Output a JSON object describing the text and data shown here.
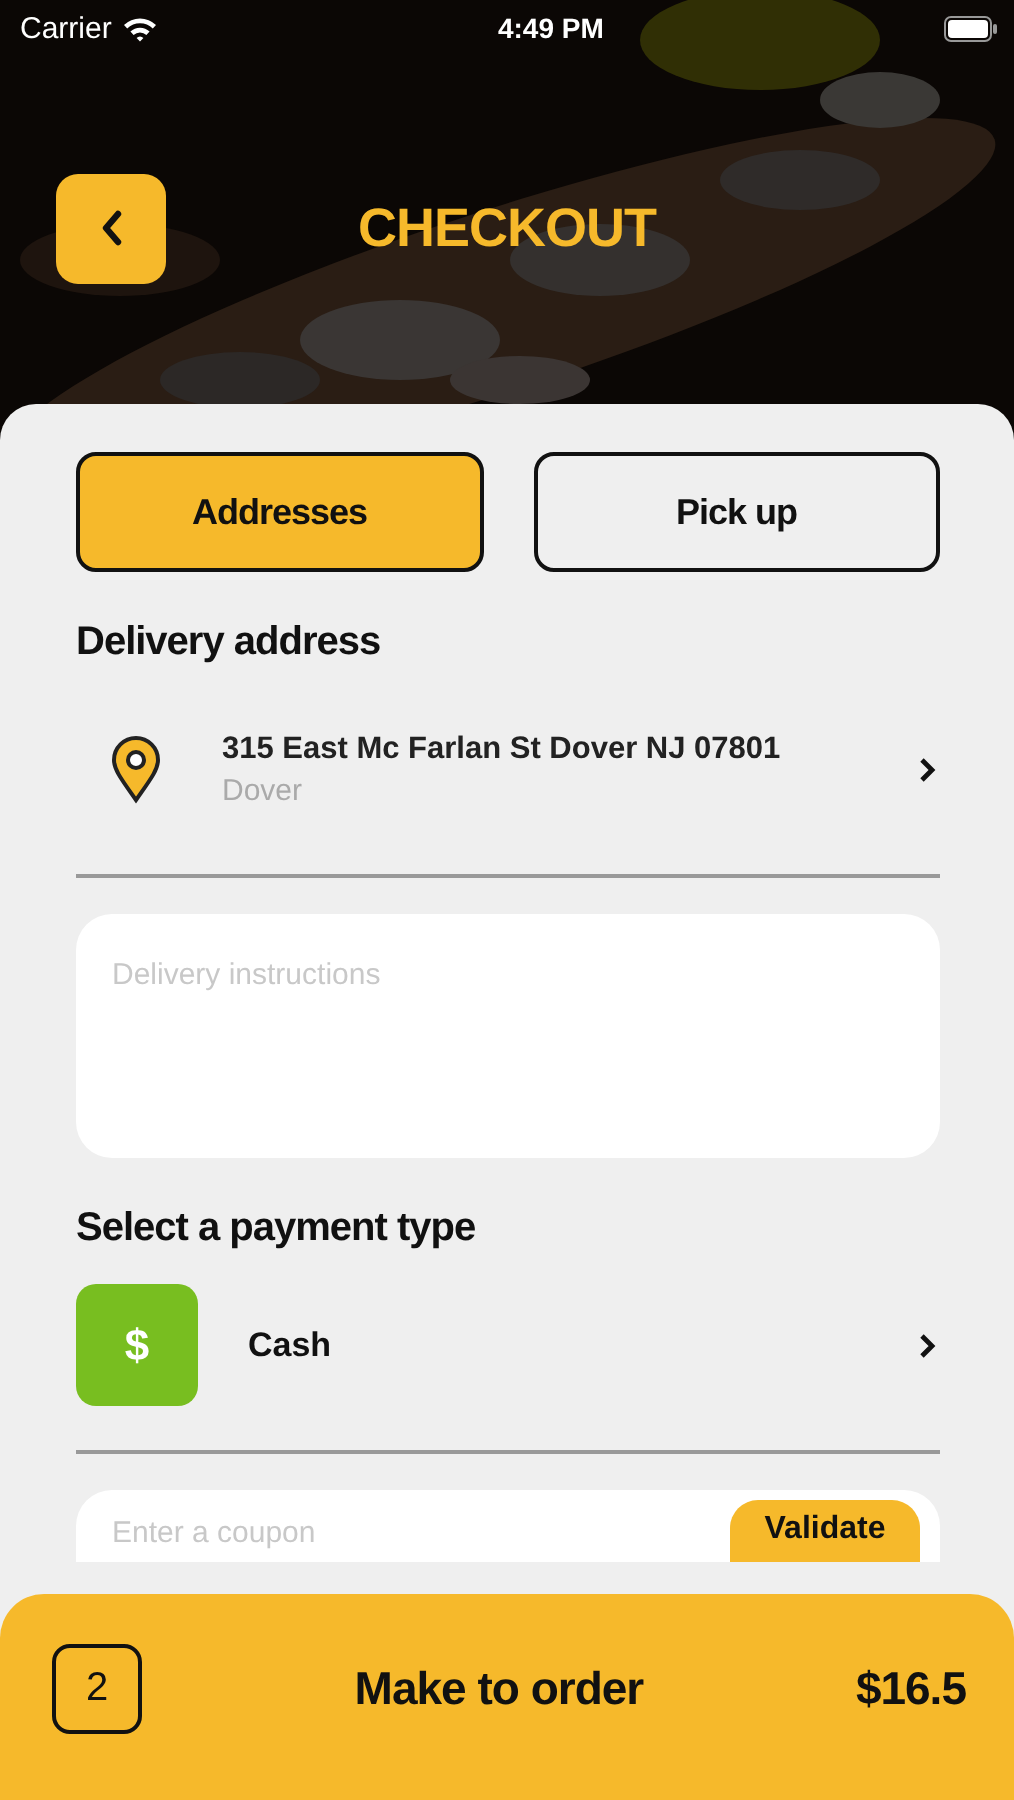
{
  "status_bar": {
    "carrier": "Carrier",
    "time": "4:49 PM"
  },
  "header": {
    "title": "CHECKOUT"
  },
  "tabs": [
    {
      "label": "Addresses",
      "selected": true
    },
    {
      "label": "Pick up",
      "selected": false
    }
  ],
  "delivery": {
    "heading": "Delivery address",
    "address": "315 East Mc Farlan St Dover NJ 07801",
    "city": "Dover",
    "instructions_placeholder": "Delivery instructions"
  },
  "payment": {
    "heading": "Select a payment type",
    "method": "Cash",
    "icon_symbol": "$"
  },
  "coupon": {
    "placeholder": "Enter a coupon",
    "button": "Validate"
  },
  "order_bar": {
    "count": "2",
    "label": "Make to order",
    "total": "$16.5"
  }
}
